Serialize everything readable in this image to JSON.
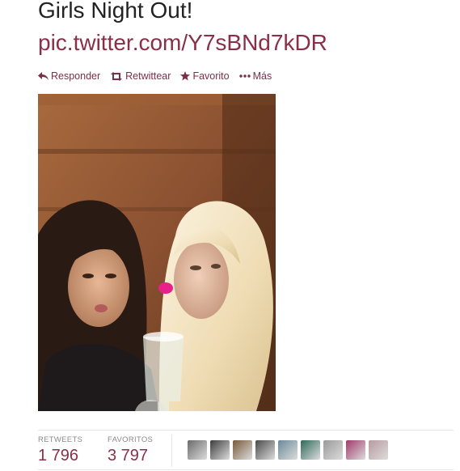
{
  "tweet": {
    "text": "Girls Night Out!",
    "link": "pic.twitter.com/Y7sBNd7kDR"
  },
  "actions": [
    {
      "label": "Responder",
      "icon": "reply-icon"
    },
    {
      "label": "Retwittear",
      "icon": "retweet-icon"
    },
    {
      "label": "Favorito",
      "icon": "star-icon"
    },
    {
      "label": "Más",
      "icon": "more-icon"
    }
  ],
  "stats": {
    "retweets_label": "RETWEETS",
    "retweets_value": "1 796",
    "favorites_label": "FAVORITOS",
    "favorites_value": "3 797"
  },
  "colors": {
    "link": "#8a2f4a",
    "action": "#7b2f47"
  },
  "avatars": [
    {
      "icon": "avatar-1",
      "color": "#6b6b6b"
    },
    {
      "icon": "avatar-2",
      "color": "#3d3d3d"
    },
    {
      "icon": "avatar-3",
      "color": "#7a5a3a"
    },
    {
      "icon": "avatar-4",
      "color": "#4a4a4a"
    },
    {
      "icon": "avatar-5",
      "color": "#6a8a9a"
    },
    {
      "icon": "avatar-6",
      "color": "#2f6a5a"
    },
    {
      "icon": "avatar-7",
      "color": "#9a9a9a"
    },
    {
      "icon": "avatar-8",
      "color": "#a03a6a"
    },
    {
      "icon": "avatar-9",
      "color": "#b89aa0"
    }
  ]
}
